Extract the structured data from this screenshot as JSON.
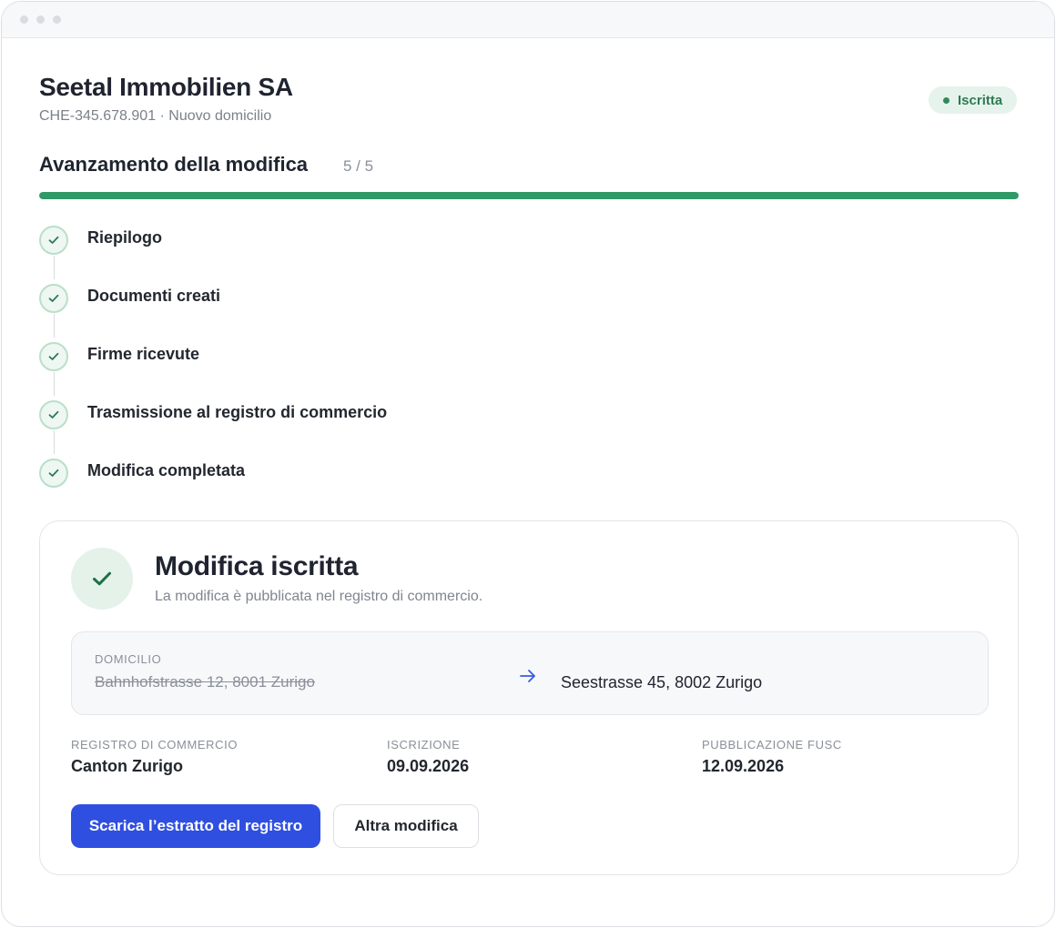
{
  "window": {
    "controls": [
      "dot",
      "dot",
      "dot"
    ]
  },
  "company": {
    "name": "Seetal Immobilien SA",
    "subtitle": "CHE-345.678.901 · Nuovo domicilio",
    "status": "Iscritta"
  },
  "progress": {
    "title": "Avanzamento della modifica",
    "count": "5 / 5",
    "fraction": 1.0
  },
  "steps": [
    {
      "label": "Riepilogo",
      "done": true
    },
    {
      "label": "Documenti creati",
      "done": true
    },
    {
      "label": "Firme ricevute",
      "done": true
    },
    {
      "label": "Trasmissione al registro di commercio",
      "done": true
    },
    {
      "label": "Modifica completata",
      "done": true
    }
  ],
  "result": {
    "title": "Modifica iscritta",
    "subtitle": "La modifica è pubblicata nel registro di commercio.",
    "domicile": {
      "label": "DOMICILIO",
      "old": "Bahnhofstrasse 12, 8001 Zurigo",
      "new": "Seestrasse 45, 8002 Zurigo"
    },
    "info": [
      {
        "label": "REGISTRO DI COMMERCIO",
        "value": "Canton Zurigo"
      },
      {
        "label": "ISCRIZIONE",
        "value": "09.09.2026"
      },
      {
        "label": "PUBBLICAZIONE FUSC",
        "value": "12.09.2026"
      }
    ],
    "actions": {
      "primary": "Scarica l’estratto del registro",
      "secondary": "Altra modifica"
    }
  },
  "colors": {
    "accent": "#2f4fe0",
    "success": "#2f9a68",
    "success_bg": "#e4f2ea"
  },
  "icons": {
    "step_check": "check-icon",
    "result_check": "check-circle-icon",
    "domicile_arrow": "arrow-right-icon",
    "status_dot": "dot-icon"
  }
}
